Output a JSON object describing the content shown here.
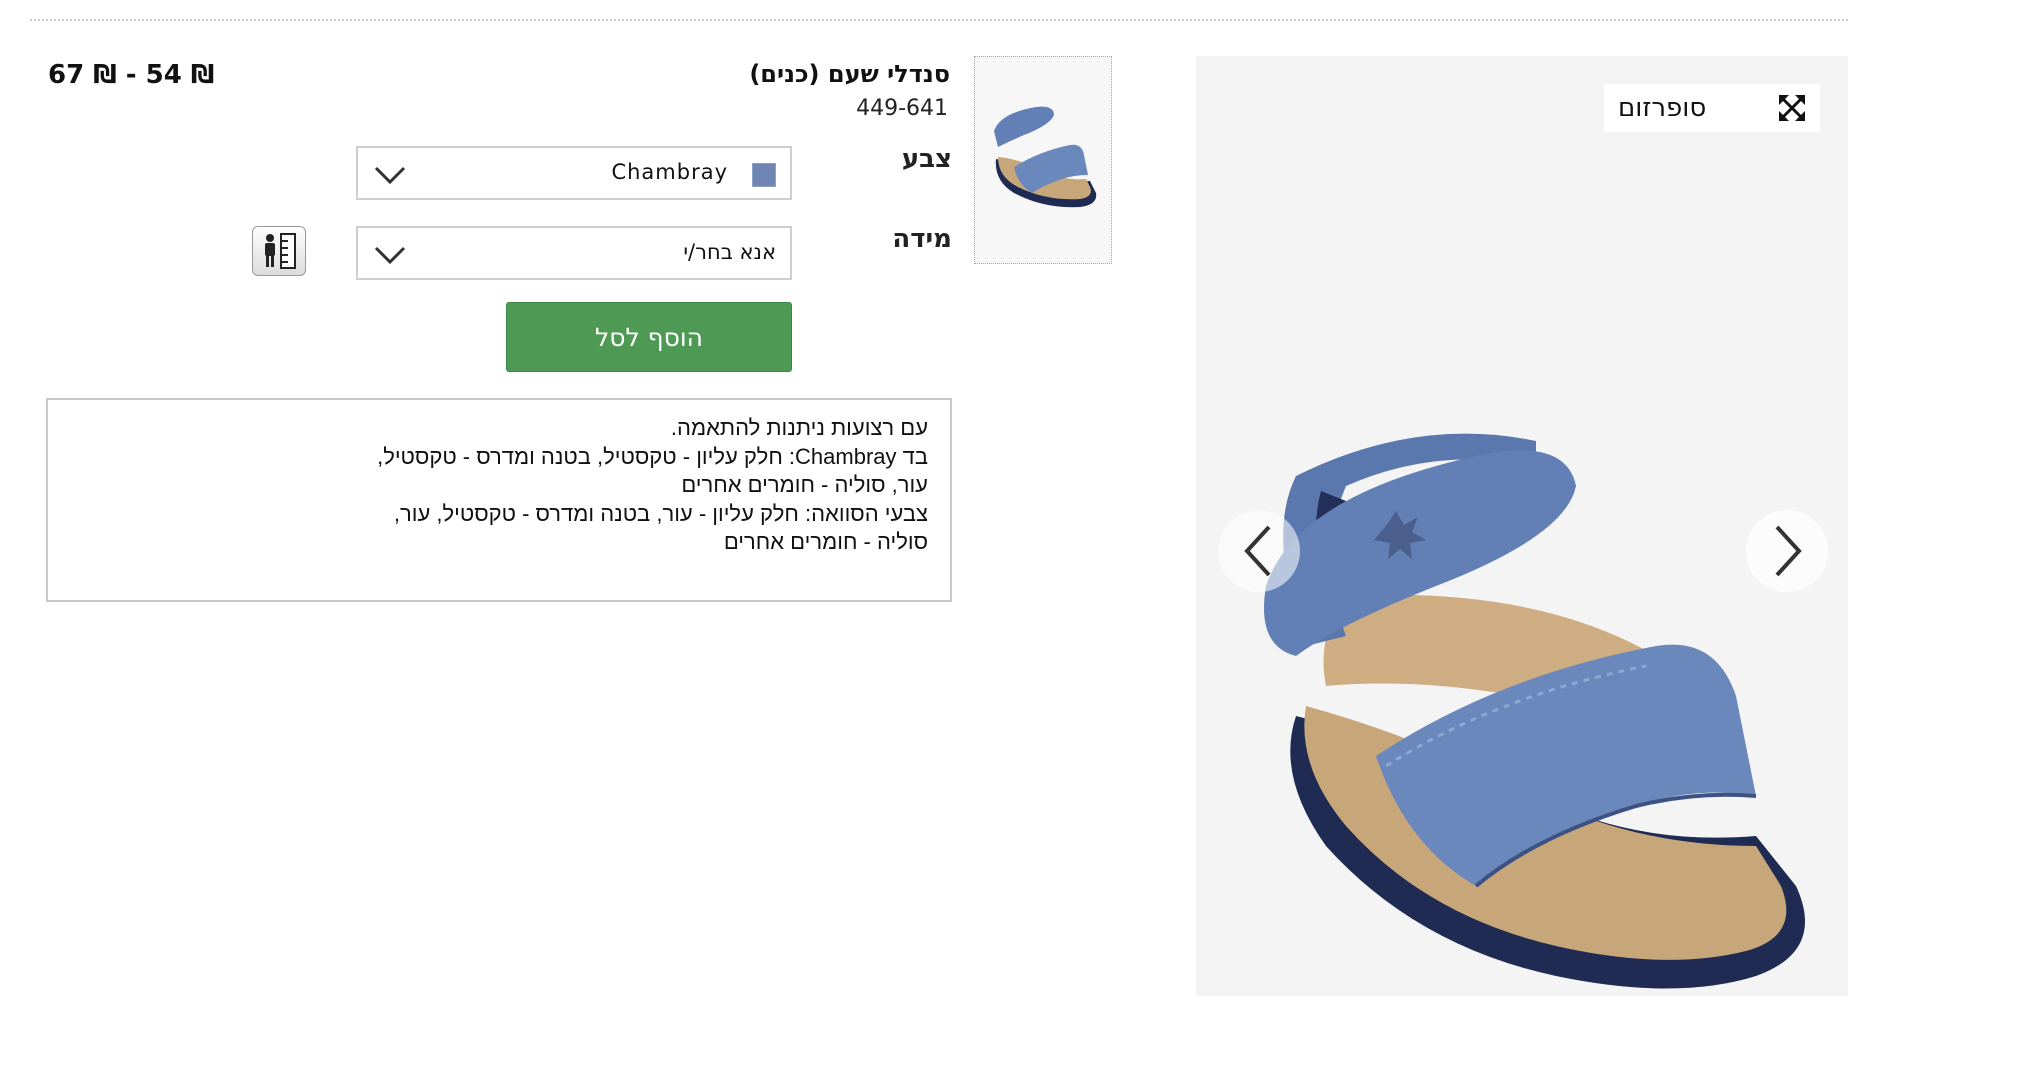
{
  "product": {
    "title": "סנדלי שעם (כנים)",
    "code": "449-641",
    "price_range": "67 ₪ - 54 ₪"
  },
  "options": {
    "color_label": "צבע",
    "color_value": "Chambray",
    "color_swatch": "#6f86b5",
    "size_label": "מידה",
    "size_placeholder": "אנא בחר/י"
  },
  "actions": {
    "add_to_cart": "הוסף לסל",
    "zoom": "סופרזום"
  },
  "description": {
    "lines": [
      "עם רצועות ניתנות להתאמה.",
      "בד Chambray: חלק עליון - טקסטיל, בטנה ומדרס - טקסטיל,",
      "עור, סוליה - חומרים אחרים",
      "צבעי הסוואה: חלק עליון - עור, בטנה ומדרס - טקסטיל, עור,",
      "סוליה - חומרים אחרים"
    ]
  },
  "icons": {
    "zoom": "expand-arrows-icon",
    "prev": "chevron-left-icon",
    "next": "chevron-right-icon",
    "size_guide": "size-guide-icon",
    "dropdown": "chevron-down-icon"
  },
  "colors": {
    "add_button": "#4e9a55",
    "image_background": "#f4f4f4"
  }
}
